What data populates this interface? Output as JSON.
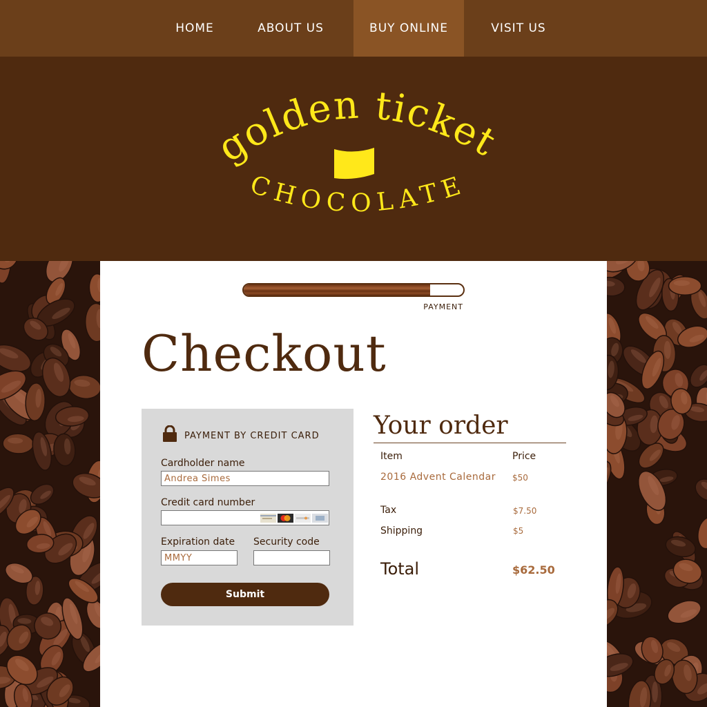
{
  "nav": {
    "items": [
      {
        "label": "HOME"
      },
      {
        "label": "ABOUT US"
      },
      {
        "label": "BUY ONLINE",
        "active": true
      },
      {
        "label": "VISIT US"
      }
    ]
  },
  "logo": {
    "line1": "golden ticket",
    "line2": "CHOCOLATE",
    "color": "#ffe81a"
  },
  "progress": {
    "label": "PAYMENT",
    "fraction": 0.85
  },
  "checkout": {
    "title": "Checkout"
  },
  "payment": {
    "title": "PAYMENT BY CREDIT CARD",
    "cardholder_label": "Cardholder name",
    "cardholder_value": "Andrea Simes",
    "card_number_label": "Credit card number",
    "card_number_value": "",
    "expiration_label": "Expiration date",
    "expiration_placeholder": "MMYY",
    "security_label": "Security code",
    "security_value": "",
    "submit_label": "Submit",
    "card_icons": [
      "visa-card-icon",
      "mastercard-icon",
      "discover-card-icon",
      "amex-card-icon"
    ]
  },
  "order": {
    "title": "Your order",
    "item_header": "Item",
    "price_header": "Price",
    "item_name": "2016 Advent Calendar",
    "item_price": "$50",
    "tax_label": "Tax",
    "tax_value": "$7.50",
    "shipping_label": "Shipping",
    "shipping_value": "$5",
    "total_label": "Total",
    "total_value": "$62.50"
  },
  "colors": {
    "dark_brown": "#4f2a0f",
    "nav_brown": "#6b3f1a",
    "nav_active": "#8a5425",
    "accent_tan": "#a86a3c",
    "panel_gray": "#d9d9d9"
  }
}
